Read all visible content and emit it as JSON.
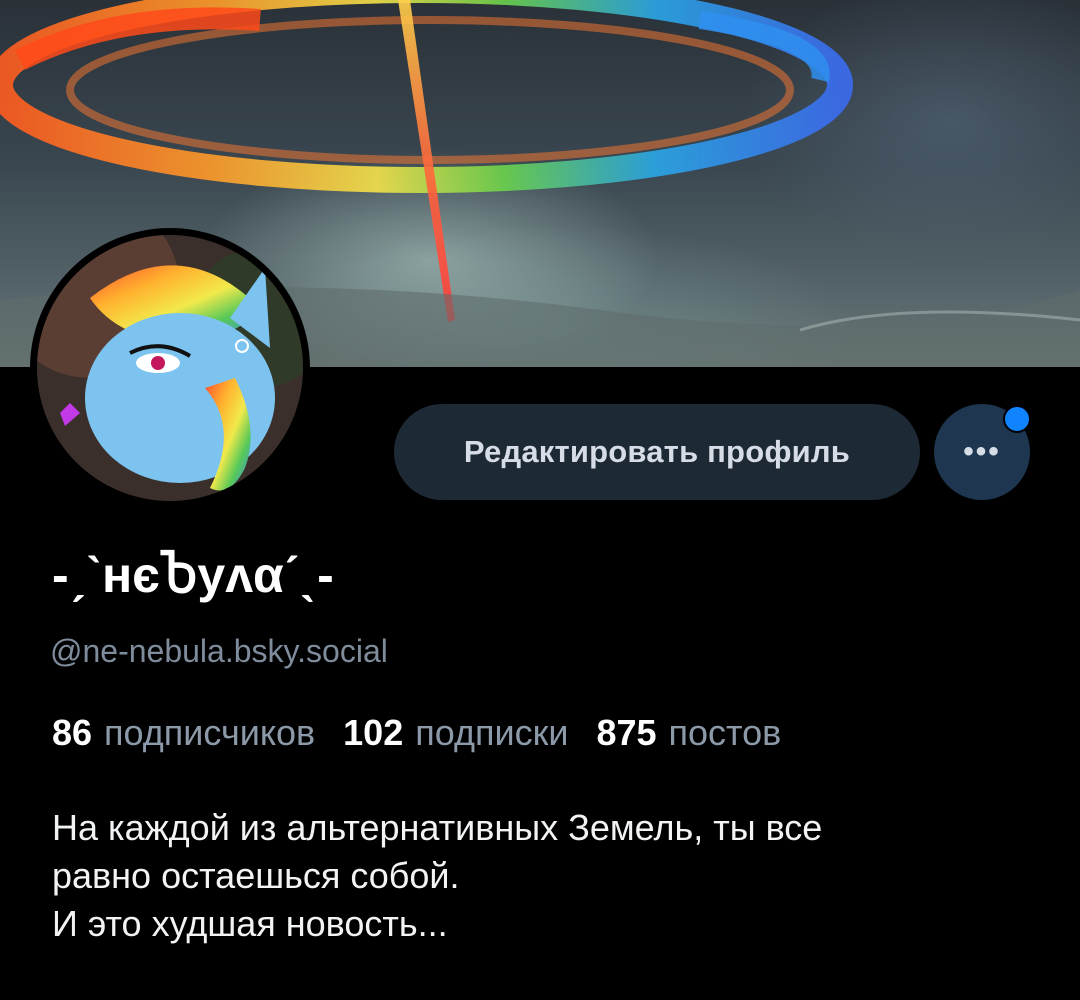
{
  "profile": {
    "display_name": "-ˏˋнєႦуʌαˊˎ-",
    "handle": "@ne-nebula.bsky.social",
    "bio_lines": [
      "На каждой из альтернативных Земель, ты все",
      "равно остаешься собой.",
      "И это худшая новость..."
    ]
  },
  "stats": {
    "followers_count": "86",
    "followers_label": "подписчиков",
    "following_count": "102",
    "following_label": "подписки",
    "posts_count": "875",
    "posts_label": "постов"
  },
  "actions": {
    "edit_profile_label": "Редактировать профиль",
    "more_label": "•••"
  },
  "colors": {
    "background": "#000000",
    "button_bg": "#1e2936",
    "more_button_bg": "#1e3650",
    "notification_dot": "#1083fe",
    "handle_text": "#7f8c9c"
  },
  "icons": {
    "more": "more-dots-icon",
    "notification": "notification-dot"
  }
}
